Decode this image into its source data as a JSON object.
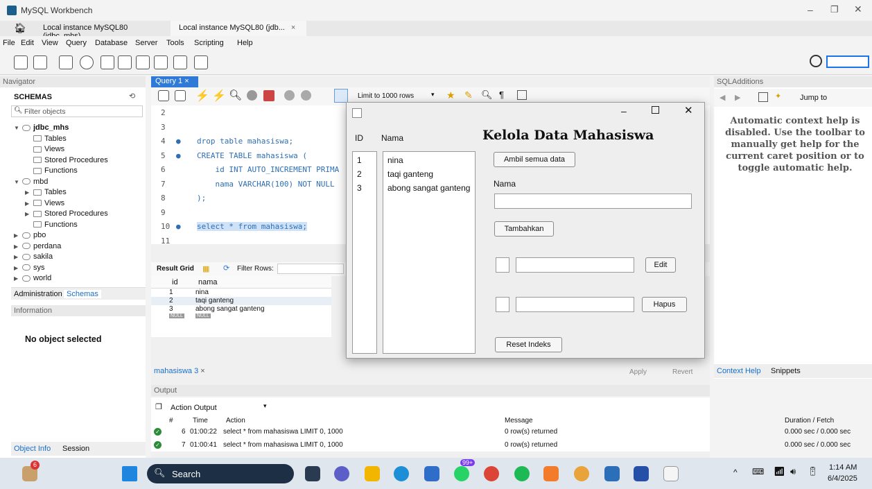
{
  "window": {
    "title": "MySQL Workbench"
  },
  "tabs": [
    {
      "label": "Local instance MySQL80 (jdbc_mhs)"
    },
    {
      "label": "Local instance MySQL80 (jdb..."
    }
  ],
  "menu": [
    "File",
    "Edit",
    "View",
    "Query",
    "Database",
    "Server",
    "Tools",
    "Scripting",
    "Help"
  ],
  "navigator": {
    "header": "Navigator",
    "schemas_label": "SCHEMAS",
    "filter_placeholder": "Filter objects",
    "tree": [
      {
        "label": "jdbc_mhs",
        "level": 0,
        "bold": true,
        "arrow": "▼"
      },
      {
        "label": "Tables",
        "level": 1
      },
      {
        "label": "Views",
        "level": 1
      },
      {
        "label": "Stored Procedures",
        "level": 1
      },
      {
        "label": "Functions",
        "level": 1
      },
      {
        "label": "mbd",
        "level": 0,
        "arrow": "▼"
      },
      {
        "label": "Tables",
        "level": 1,
        "arrow": "▶"
      },
      {
        "label": "Views",
        "level": 1,
        "arrow": "▶"
      },
      {
        "label": "Stored Procedures",
        "level": 1,
        "arrow": "▶"
      },
      {
        "label": "Functions",
        "level": 1
      },
      {
        "label": "pbo",
        "level": 0,
        "arrow": "▶"
      },
      {
        "label": "perdana",
        "level": 0,
        "arrow": "▶"
      },
      {
        "label": "sakila",
        "level": 0,
        "arrow": "▶"
      },
      {
        "label": "sys",
        "level": 0,
        "arrow": "▶"
      },
      {
        "label": "world",
        "level": 0,
        "arrow": "▶"
      }
    ],
    "tab_admin": "Administration",
    "tab_schemas": "Schemas",
    "info_header": "Information",
    "no_object": "No object selected",
    "tab_objinfo": "Object Info",
    "tab_session": "Session"
  },
  "query": {
    "tab": "Query 1",
    "limit": "Limit to 1000 rows",
    "lines": [
      {
        "n": "2",
        "code": ""
      },
      {
        "n": "3",
        "code": ""
      },
      {
        "n": "4",
        "code": "drop table mahasiswa;"
      },
      {
        "n": "5",
        "code": "CREATE TABLE mahasiswa ("
      },
      {
        "n": "6",
        "code": "    id INT AUTO_INCREMENT PRIMA"
      },
      {
        "n": "7",
        "code": "    nama VARCHAR(100) NOT NULL"
      },
      {
        "n": "8",
        "code": ");"
      },
      {
        "n": "9",
        "code": ""
      },
      {
        "n": "10",
        "code": "select * from mahasiswa;"
      },
      {
        "n": "11",
        "code": ""
      }
    ]
  },
  "result": {
    "label": "Result Grid",
    "filter": "Filter Rows:",
    "columns": [
      "id",
      "nama"
    ],
    "rows": [
      [
        "1",
        "nina"
      ],
      [
        "2",
        "taqi ganteng"
      ],
      [
        "3",
        "abong sangat ganteng"
      ],
      [
        "NULL",
        "NULL"
      ]
    ],
    "tab": "mahasiswa 3",
    "apply": "Apply",
    "revert": "Revert"
  },
  "output": {
    "header": "Output",
    "mode": "Action Output",
    "columns": [
      "#",
      "Time",
      "Action",
      "Message",
      "Duration / Fetch"
    ],
    "rows": [
      {
        "num": "6",
        "time": "01:00:22",
        "action": "select * from mahasiswa LIMIT 0, 1000",
        "message": "0 row(s) returned",
        "duration": "0.000 sec / 0.000 sec"
      },
      {
        "num": "7",
        "time": "01:00:41",
        "action": "select * from mahasiswa LIMIT 0, 1000",
        "message": "0 row(s) returned",
        "duration": "0.000 sec / 0.000 sec"
      }
    ]
  },
  "sqladd": {
    "header": "SQLAdditions",
    "jump": "Jump to",
    "help": "Automatic context help is disabled. Use the toolbar to manually get help for the current caret position or to toggle automatic help.",
    "tab_context": "Context Help",
    "tab_snippets": "Snippets"
  },
  "dialog": {
    "title": "Kelola Data Mahasiswa",
    "col_id": "ID",
    "col_nama": "Nama",
    "ids": [
      "1",
      "2",
      "3"
    ],
    "names": [
      "nina",
      "taqi ganteng",
      "abong sangat ganteng"
    ],
    "btn_ambil": "Ambil semua data",
    "lbl_nama": "Nama",
    "btn_tambah": "Tambahkan",
    "btn_edit": "Edit",
    "btn_hapus": "Hapus",
    "btn_reset": "Reset Indeks"
  },
  "taskbar": {
    "search": "Search",
    "badge_count": "6",
    "badge_99": "99+",
    "time": "1:14 AM",
    "date": "6/4/2025"
  }
}
